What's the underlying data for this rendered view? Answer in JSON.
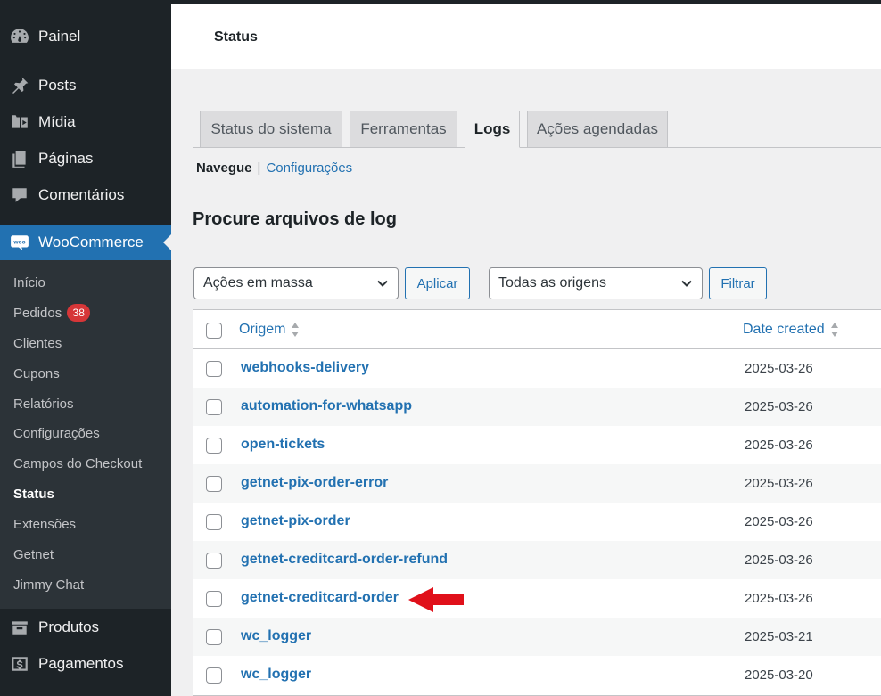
{
  "sidebar": {
    "top_items": [
      {
        "label": "Painel",
        "icon": "dashboard-icon"
      },
      {
        "label": "Posts",
        "icon": "pin-icon"
      },
      {
        "label": "Mídia",
        "icon": "media-icon"
      },
      {
        "label": "Páginas",
        "icon": "pages-icon"
      },
      {
        "label": "Comentários",
        "icon": "comments-icon"
      }
    ],
    "active_item": {
      "label": "WooCommerce",
      "icon": "woocommerce-icon"
    },
    "submenu": [
      {
        "label": "Início"
      },
      {
        "label": "Pedidos",
        "badge": "38"
      },
      {
        "label": "Clientes"
      },
      {
        "label": "Cupons"
      },
      {
        "label": "Relatórios"
      },
      {
        "label": "Configurações"
      },
      {
        "label": "Campos do Checkout"
      },
      {
        "label": "Status",
        "current": true
      },
      {
        "label": "Extensões"
      },
      {
        "label": "Getnet"
      },
      {
        "label": "Jimmy Chat"
      }
    ],
    "bottom_items": [
      {
        "label": "Produtos",
        "icon": "products-icon"
      },
      {
        "label": "Pagamentos",
        "icon": "payments-icon"
      }
    ]
  },
  "header": {
    "title": "Status"
  },
  "tabs": [
    {
      "label": "Status do sistema"
    },
    {
      "label": "Ferramentas"
    },
    {
      "label": "Logs",
      "active": true
    },
    {
      "label": "Ações agendadas"
    }
  ],
  "subsubsub": {
    "current": "Navegue",
    "separator": "|",
    "link": "Configurações"
  },
  "page_heading": "Procure arquivos de log",
  "controls": {
    "bulk_select": "Ações em massa",
    "apply_button": "Aplicar",
    "source_select": "Todas as origens",
    "filter_button": "Filtrar"
  },
  "table": {
    "col_source": "Origem",
    "col_date": "Date created",
    "rows": [
      {
        "source": "webhooks-delivery",
        "date": "2025-03-26"
      },
      {
        "source": "automation-for-whatsapp",
        "date": "2025-03-26"
      },
      {
        "source": "open-tickets",
        "date": "2025-03-26"
      },
      {
        "source": "getnet-pix-order-error",
        "date": "2025-03-26"
      },
      {
        "source": "getnet-pix-order",
        "date": "2025-03-26"
      },
      {
        "source": "getnet-creditcard-order-refund",
        "date": "2025-03-26"
      },
      {
        "source": "getnet-creditcard-order",
        "date": "2025-03-26"
      },
      {
        "source": "wc_logger",
        "date": "2025-03-21"
      },
      {
        "source": "wc_logger",
        "date": "2025-03-20"
      }
    ]
  },
  "colors": {
    "accent": "#2271b1",
    "sidebar": "#1d2327",
    "submenu": "#2c3338",
    "badge": "#d63638",
    "arrow": "#e0101a"
  }
}
